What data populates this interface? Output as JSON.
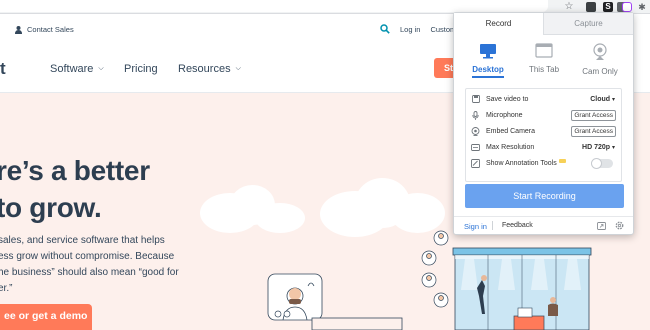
{
  "browser": {
    "extensions": [
      {
        "name": "star-icon",
        "glyph": "☆"
      },
      {
        "name": "extension-dark-icon",
        "glyph": "▪"
      },
      {
        "name": "extension-s-icon",
        "glyph": "S"
      },
      {
        "name": "extension-doc-icon",
        "glyph": "▤"
      },
      {
        "name": "extension-recorder-icon",
        "glyph": "◉"
      },
      {
        "name": "puzzle-icon",
        "glyph": "✱"
      }
    ]
  },
  "site": {
    "utility_nav": {
      "contact_sales": "Contact Sales",
      "login": "Log in",
      "customer_fragment": "Custom"
    },
    "main_nav": {
      "logo_fragment": "t",
      "items": [
        "Software",
        "Pricing",
        "Resources"
      ],
      "cta_fragment": "St"
    },
    "hero": {
      "headline_lines": [
        "re’s a better",
        "to grow."
      ],
      "paragraph_lines": [
        "sales, and service software that helps",
        "ess grow without compromise. Because",
        "he business” should also mean “good for",
        "er.”"
      ],
      "cta": "ee or get a demo"
    },
    "colors": {
      "accent": "#ff7a59",
      "hero_bg": "#fdf0ec",
      "text": "#33475b"
    }
  },
  "popup": {
    "tabs": {
      "active": "Record",
      "inactive": "Capture"
    },
    "modes": [
      {
        "label": "Desktop",
        "icon": "monitor-icon",
        "selected": true
      },
      {
        "label": "This Tab",
        "icon": "browser-tab-icon",
        "selected": false
      },
      {
        "label": "Cam Only",
        "icon": "webcam-icon",
        "selected": false
      }
    ],
    "settings": {
      "save_video_label": "Save video to",
      "save_video_value": "Cloud",
      "microphone_label": "Microphone",
      "microphone_action": "Grant Access",
      "camera_label": "Embed Camera",
      "camera_action": "Grant Access",
      "resolution_label": "Max Resolution",
      "resolution_value": "HD 720p",
      "annotation_label": "Show Annotation Tools",
      "annotation_enabled": false
    },
    "start_button": "Start Recording",
    "footer": {
      "sign_in": "Sign in",
      "feedback": "Feedback"
    },
    "colors": {
      "primary": "#2b73d6",
      "button": "#6aa2ef"
    }
  }
}
